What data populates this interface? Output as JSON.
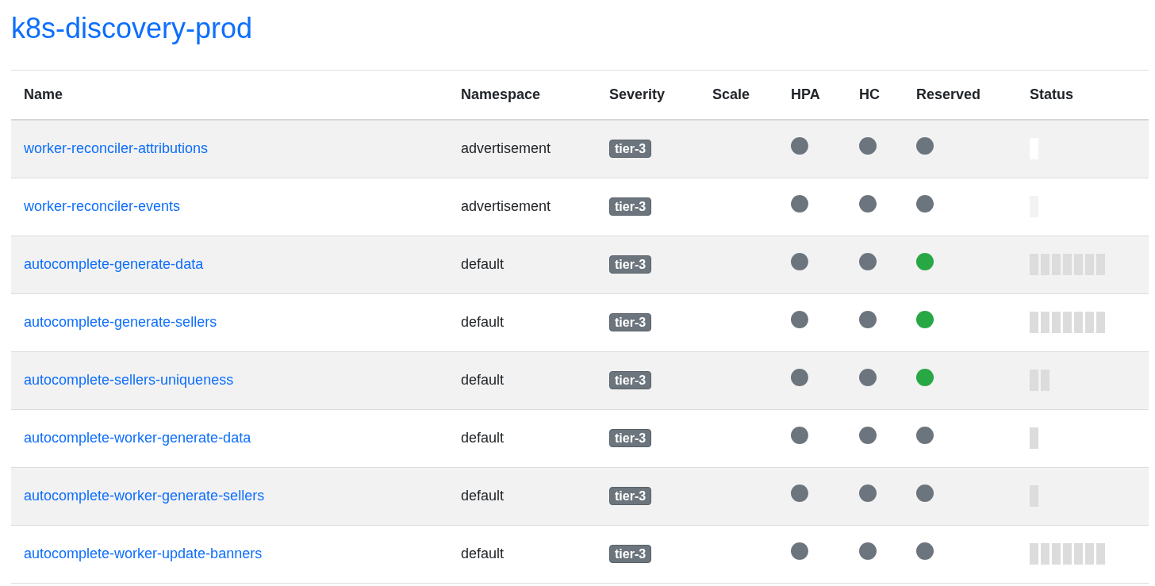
{
  "title": "k8s-discovery-prod",
  "table": {
    "columns": [
      "Name",
      "Namespace",
      "Severity",
      "Scale",
      "HPA",
      "HC",
      "Reserved",
      "Status"
    ],
    "rows": [
      {
        "name": "worker-reconciler-attributions",
        "namespace": "advertisement",
        "severity": "tier-3",
        "hpa": {
          "color": "#6c757d"
        },
        "hc": {
          "color": "#6c757d"
        },
        "reserved": {
          "color": "#6c757d"
        },
        "status_bars": [
          {
            "color": "#ffffff"
          }
        ]
      },
      {
        "name": "worker-reconciler-events",
        "namespace": "advertisement",
        "severity": "tier-3",
        "hpa": {
          "color": "#6c757d"
        },
        "hc": {
          "color": "#6c757d"
        },
        "reserved": {
          "color": "#6c757d"
        },
        "status_bars": [
          {
            "color": "#f3f3f3"
          }
        ]
      },
      {
        "name": "autocomplete-generate-data",
        "namespace": "default",
        "severity": "tier-3",
        "hpa": {
          "color": "#6c757d"
        },
        "hc": {
          "color": "#6c757d"
        },
        "reserved": {
          "color": "#28a745"
        },
        "status_bars": [
          {
            "color": "#dcdcdc"
          },
          {
            "color": "#dcdcdc"
          },
          {
            "color": "#dcdcdc"
          },
          {
            "color": "#dcdcdc"
          },
          {
            "color": "#dcdcdc"
          },
          {
            "color": "#dcdcdc"
          },
          {
            "color": "#dcdcdc"
          }
        ]
      },
      {
        "name": "autocomplete-generate-sellers",
        "namespace": "default",
        "severity": "tier-3",
        "hpa": {
          "color": "#6c757d"
        },
        "hc": {
          "color": "#6c757d"
        },
        "reserved": {
          "color": "#28a745"
        },
        "status_bars": [
          {
            "color": "#dcdcdc"
          },
          {
            "color": "#dcdcdc"
          },
          {
            "color": "#dcdcdc"
          },
          {
            "color": "#dcdcdc"
          },
          {
            "color": "#dcdcdc"
          },
          {
            "color": "#dcdcdc"
          },
          {
            "color": "#dcdcdc"
          }
        ]
      },
      {
        "name": "autocomplete-sellers-uniqueness",
        "namespace": "default",
        "severity": "tier-3",
        "hpa": {
          "color": "#6c757d"
        },
        "hc": {
          "color": "#6c757d"
        },
        "reserved": {
          "color": "#28a745"
        },
        "status_bars": [
          {
            "color": "#dcdcdc"
          },
          {
            "color": "#dcdcdc"
          }
        ]
      },
      {
        "name": "autocomplete-worker-generate-data",
        "namespace": "default",
        "severity": "tier-3",
        "hpa": {
          "color": "#6c757d"
        },
        "hc": {
          "color": "#6c757d"
        },
        "reserved": {
          "color": "#6c757d"
        },
        "status_bars": [
          {
            "color": "#dcdcdc"
          }
        ]
      },
      {
        "name": "autocomplete-worker-generate-sellers",
        "namespace": "default",
        "severity": "tier-3",
        "hpa": {
          "color": "#6c757d"
        },
        "hc": {
          "color": "#6c757d"
        },
        "reserved": {
          "color": "#6c757d"
        },
        "status_bars": [
          {
            "color": "#dcdcdc"
          }
        ]
      },
      {
        "name": "autocomplete-worker-update-banners",
        "namespace": "default",
        "severity": "tier-3",
        "hpa": {
          "color": "#6c757d"
        },
        "hc": {
          "color": "#6c757d"
        },
        "reserved": {
          "color": "#6c757d"
        },
        "status_bars": [
          {
            "color": "#dcdcdc"
          },
          {
            "color": "#dcdcdc"
          },
          {
            "color": "#dcdcdc"
          },
          {
            "color": "#dcdcdc"
          },
          {
            "color": "#dcdcdc"
          },
          {
            "color": "#dcdcdc"
          },
          {
            "color": "#dcdcdc"
          }
        ]
      }
    ]
  }
}
